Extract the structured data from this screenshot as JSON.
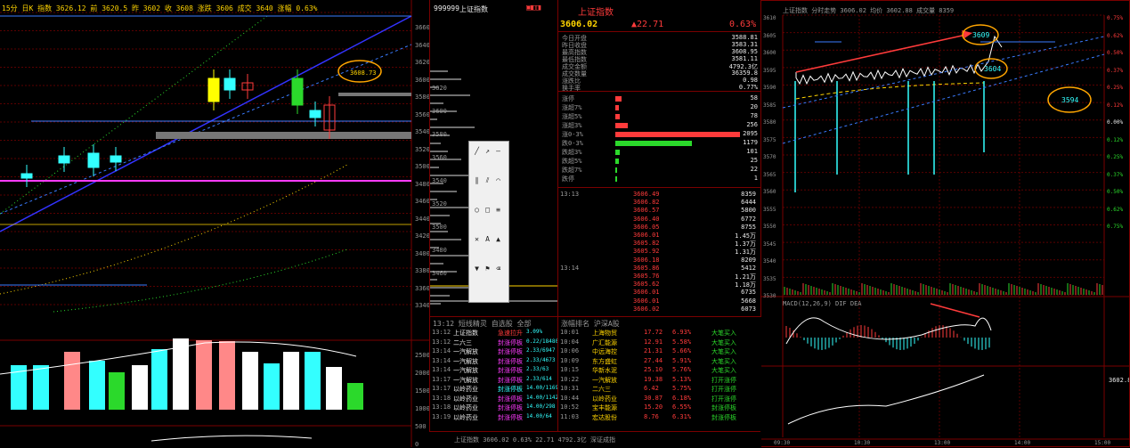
{
  "kline_header": {
    "text": "15分  日K  指数  3626.12  前  3620.5  昨  3602  收  3608  涨跌  3606  成交  3640  涨幅  0.63%"
  },
  "kline_price_levels": [
    "3660",
    "3640",
    "3620",
    "3600",
    "3580",
    "3560",
    "3540",
    "3520",
    "3500",
    "3480",
    "3460",
    "3440",
    "3420",
    "3400",
    "3380",
    "3360",
    "3340"
  ],
  "kline_annotation": "3608.73",
  "volume_levels": [
    "2500",
    "2000",
    "1500",
    "1000",
    "500",
    "0"
  ],
  "mid_header": {
    "code": "999999",
    "name": "上证指数"
  },
  "depth_labels": [
    "3620",
    "3600",
    "3580",
    "3560",
    "3540",
    "3520",
    "3500",
    "3480",
    "3460"
  ],
  "index_panel": {
    "title": "上证指数",
    "price": "3606.02",
    "change": "▲22.71",
    "pct": "0.63%",
    "stats": [
      {
        "label": "今日开盘",
        "value": "3588.81"
      },
      {
        "label": "昨日收盘",
        "value": "3583.31"
      },
      {
        "label": "最高指数",
        "value": "3608.95"
      },
      {
        "label": "最低指数",
        "value": "3581.11"
      },
      {
        "label": "成交金额",
        "value": "4792.3亿"
      },
      {
        "label": "成交数量",
        "value": "36359.8"
      },
      {
        "label": "涨跌比",
        "value": "0.98"
      },
      {
        "label": "换手率",
        "value": "0.77%"
      }
    ],
    "distribution": [
      {
        "label": "涨停",
        "count": "58",
        "bar": 4,
        "color": "#ff3b3b"
      },
      {
        "label": "涨超7%",
        "count": "20",
        "bar": 2,
        "color": "#ff3b3b"
      },
      {
        "label": "涨超5%",
        "count": "78",
        "bar": 3,
        "color": "#ff3b3b"
      },
      {
        "label": "涨超3%",
        "count": "256",
        "bar": 8,
        "color": "#ff3b3b"
      },
      {
        "label": "涨0-3%",
        "count": "2095",
        "bar": 78,
        "color": "#ff3b3b"
      },
      {
        "label": "跌0-3%",
        "count": "1179",
        "bar": 48,
        "color": "#2bd92b"
      },
      {
        "label": "跌超3%",
        "count": "101",
        "bar": 3,
        "color": "#2bd92b"
      },
      {
        "label": "跌超5%",
        "count": "25",
        "bar": 2,
        "color": "#2bd92b"
      },
      {
        "label": "跌超7%",
        "count": "22",
        "bar": 1,
        "color": "#2bd92b"
      },
      {
        "label": "跌停",
        "count": "1",
        "bar": 1,
        "color": "#2bd92b"
      }
    ]
  },
  "ticks": [
    {
      "time": "13:13",
      "price": "3606.49",
      "vol": "8359"
    },
    {
      "time": "",
      "price": "3606.82",
      "vol": "6444"
    },
    {
      "time": "",
      "price": "3606.57",
      "vol": "5800"
    },
    {
      "time": "",
      "price": "3606.40",
      "vol": "6772"
    },
    {
      "time": "",
      "price": "3606.05",
      "vol": "8755"
    },
    {
      "time": "",
      "price": "3606.01",
      "vol": "1.45万"
    },
    {
      "time": "",
      "price": "3605.82",
      "vol": "1.37万"
    },
    {
      "time": "",
      "price": "3605.92",
      "vol": "1.31万"
    },
    {
      "time": "",
      "price": "3606.18",
      "vol": "8209"
    },
    {
      "time": "13:14",
      "price": "3605.86",
      "vol": "5412"
    },
    {
      "time": "",
      "price": "3605.76",
      "vol": "1.21万"
    },
    {
      "time": "",
      "price": "3605.62",
      "vol": "1.18万"
    },
    {
      "time": "",
      "price": "3606.01",
      "vol": "6735"
    },
    {
      "time": "",
      "price": "3606.01",
      "vol": "5668"
    },
    {
      "time": "",
      "price": "3606.02",
      "vol": "6073"
    }
  ],
  "alerts_header": "13:12  短线精灵  自选股  全部",
  "alerts": [
    {
      "time": "13:12",
      "stock": "上证指数",
      "type": "急速拉升",
      "detail": "3.09%",
      "tc": "#ff3b3b"
    },
    {
      "time": "13:12",
      "stock": "二六三",
      "type": "封涨停板",
      "detail": "0.22/184804",
      "tc": "#ff3bff"
    },
    {
      "time": "13:14",
      "stock": "一汽解放",
      "type": "封涨停板",
      "detail": "2.33/6947",
      "tc": "#ff3bff"
    },
    {
      "time": "13:14",
      "stock": "一汽解放",
      "type": "封涨停板",
      "detail": "2.33/4673",
      "tc": "#ff3bff"
    },
    {
      "time": "13:14",
      "stock": "一汽解放",
      "type": "封涨停板",
      "detail": "2.33/63",
      "tc": "#ff3bff"
    },
    {
      "time": "13:17",
      "stock": "一汽解放",
      "type": "封涨停板",
      "detail": "2.33/614",
      "tc": "#ff3bff"
    },
    {
      "time": "13:17",
      "stock": "以岭药业",
      "type": "封涨停板",
      "detail": "14.00/11694",
      "tc": "#3ff"
    },
    {
      "time": "13:18",
      "stock": "以岭药业",
      "type": "封涨停板",
      "detail": "14.00/1142",
      "tc": "#ff3bff"
    },
    {
      "time": "13:18",
      "stock": "以岭药业",
      "type": "封涨停板",
      "detail": "14.00/298",
      "tc": "#ff3bff"
    },
    {
      "time": "13:19",
      "stock": "以岭药业",
      "type": "封涨停板",
      "detail": "14.00/64",
      "tc": "#ff3bff"
    }
  ],
  "rank_header": "涨幅排名  沪深A股",
  "ranks": [
    {
      "time": "10:01",
      "name": "上海物贸",
      "price": "17.72",
      "pct": "6.93%",
      "note": "大笔买入"
    },
    {
      "time": "10:04",
      "name": "广汇能源",
      "price": "12.91",
      "pct": "5.58%",
      "note": "大笔买入"
    },
    {
      "time": "10:06",
      "name": "中远海控",
      "price": "21.31",
      "pct": "5.66%",
      "note": "大笔买入"
    },
    {
      "time": "10:09",
      "name": "东方盛虹",
      "price": "27.44",
      "pct": "5.91%",
      "note": "大笔买入"
    },
    {
      "time": "10:15",
      "name": "华新水泥",
      "price": "25.10",
      "pct": "5.76%",
      "note": "大笔买入"
    },
    {
      "time": "10:22",
      "name": "一汽解放",
      "price": "19.38",
      "pct": "5.13%",
      "note": "打开涨停"
    },
    {
      "time": "10:31",
      "name": "二六三",
      "price": "6.42",
      "pct": "5.75%",
      "note": "打开涨停"
    },
    {
      "time": "10:44",
      "name": "以岭药业",
      "price": "30.87",
      "pct": "6.18%",
      "note": "打开涨停"
    },
    {
      "time": "10:52",
      "name": "宝丰能源",
      "price": "15.20",
      "pct": "6.55%",
      "note": "封涨停板"
    },
    {
      "time": "11:03",
      "name": "宏达股份",
      "price": "8.76",
      "pct": "6.31%",
      "note": "封涨停板"
    }
  ],
  "status_bar": "上证指数  3606.02  0.63%  22.71  4792.3亿  深证成指",
  "intraday": {
    "header": "上证指数  分时走势  3606.02  均价  3602.88  成交量 8359",
    "labels": [
      {
        "value": "3609",
        "pos": "top"
      },
      {
        "value": "3604",
        "pos": "mid"
      },
      {
        "value": "3594",
        "pos": "right"
      }
    ],
    "price_axis": [
      "3610",
      "3605",
      "3600",
      "3595",
      "3590",
      "3585",
      "3580",
      "3575",
      "3570",
      "3565",
      "3560",
      "3555",
      "3550",
      "3545",
      "3540",
      "3535",
      "3530"
    ],
    "pct_axis": [
      "0.75%",
      "0.62%",
      "0.50%",
      "0.37%",
      "0.25%",
      "0.12%",
      "0.00%",
      "0.12%",
      "0.25%",
      "0.37%",
      "0.50%",
      "0.62%",
      "0.75%"
    ],
    "time_axis": [
      "09:30",
      "10:30",
      "13:00",
      "14:00",
      "15:00"
    ],
    "macd_header": "MACD(12,26,9)  DIF  DEA",
    "bottom_value": "3602.88"
  },
  "tool_icons": [
    "line-tool",
    "ray-tool",
    "segment-tool",
    "parallel-tool",
    "channel-tool",
    "arc-tool",
    "circle-tool",
    "rect-tool",
    "fib-tool",
    "gann-tool",
    "text-tool",
    "arrow-up-tool",
    "arrow-down-tool",
    "flag-tool",
    "delete-tool"
  ]
}
